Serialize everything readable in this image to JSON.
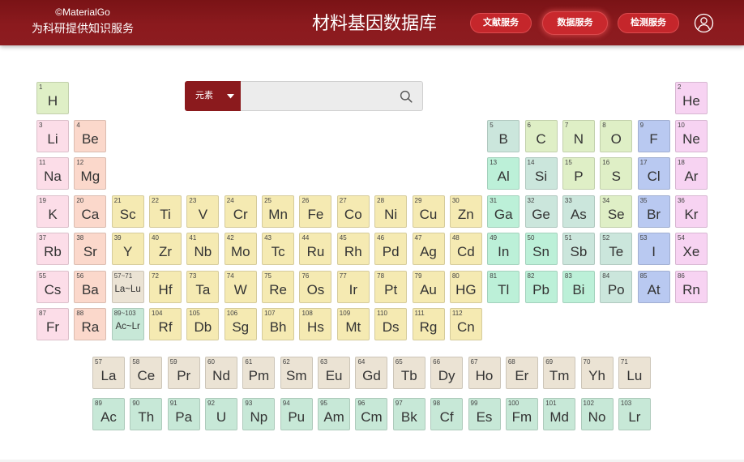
{
  "header": {
    "brand_mark": "©MaterialGo",
    "tagline": "为科研提供知识服务",
    "title": "材料基因数据库",
    "nav": [
      {
        "label": "文献服务"
      },
      {
        "label": "数据服务"
      },
      {
        "label": "检测服务"
      }
    ],
    "avatar_icon": "user-circle-icon",
    "colors": {
      "bar": "#8b1a1e",
      "pill": "#c5262b"
    }
  },
  "search": {
    "type_label": "元素",
    "caret_icon": "caret-down-icon",
    "value": "",
    "search_icon": "search-icon"
  },
  "periods": [
    [
      {
        "n": "1",
        "s": "H",
        "c": "#dfefc6"
      },
      {
        "n": "2",
        "s": "He",
        "c": "#f7d3f2"
      }
    ],
    [
      {
        "n": "3",
        "s": "Li",
        "c": "#fcdde8"
      },
      {
        "n": "4",
        "s": "Be",
        "c": "#fbd8cb"
      },
      {
        "n": "5",
        "s": "B",
        "c": "#cbe6dc"
      },
      {
        "n": "6",
        "s": "C",
        "c": "#dfefc6"
      },
      {
        "n": "7",
        "s": "N",
        "c": "#dfefc6"
      },
      {
        "n": "8",
        "s": "O",
        "c": "#dfefc6"
      },
      {
        "n": "9",
        "s": "F",
        "c": "#b9c9f1"
      },
      {
        "n": "10",
        "s": "Ne",
        "c": "#f7d3f2"
      }
    ],
    [
      {
        "n": "11",
        "s": "Na",
        "c": "#fcdde8"
      },
      {
        "n": "12",
        "s": "Mg",
        "c": "#fbd8cb"
      },
      {
        "n": "13",
        "s": "Al",
        "c": "#bcf0d8"
      },
      {
        "n": "14",
        "s": "Si",
        "c": "#cbe6dc"
      },
      {
        "n": "15",
        "s": "P",
        "c": "#dfefc6"
      },
      {
        "n": "16",
        "s": "S",
        "c": "#dfefc6"
      },
      {
        "n": "17",
        "s": "Cl",
        "c": "#b9c9f1"
      },
      {
        "n": "18",
        "s": "Ar",
        "c": "#f7d3f2"
      }
    ],
    [
      {
        "n": "19",
        "s": "K",
        "c": "#fcdde8"
      },
      {
        "n": "20",
        "s": "Ca",
        "c": "#fbd8cb"
      },
      {
        "n": "21",
        "s": "Sc",
        "c": "#f5eab2"
      },
      {
        "n": "22",
        "s": "Ti",
        "c": "#f5eab2"
      },
      {
        "n": "23",
        "s": "V",
        "c": "#f5eab2"
      },
      {
        "n": "24",
        "s": "Cr",
        "c": "#f5eab2"
      },
      {
        "n": "25",
        "s": "Mn",
        "c": "#f5eab2"
      },
      {
        "n": "26",
        "s": "Fe",
        "c": "#f5eab2"
      },
      {
        "n": "27",
        "s": "Co",
        "c": "#f5eab2"
      },
      {
        "n": "28",
        "s": "Ni",
        "c": "#f5eab2"
      },
      {
        "n": "29",
        "s": "Cu",
        "c": "#f5eab2"
      },
      {
        "n": "30",
        "s": "Zn",
        "c": "#f5eab2"
      },
      {
        "n": "31",
        "s": "Ga",
        "c": "#bcf0d8"
      },
      {
        "n": "32",
        "s": "Ge",
        "c": "#cbe6dc"
      },
      {
        "n": "33",
        "s": "As",
        "c": "#cbe6dc"
      },
      {
        "n": "34",
        "s": "Se",
        "c": "#dfefc6"
      },
      {
        "n": "35",
        "s": "Br",
        "c": "#b9c9f1"
      },
      {
        "n": "36",
        "s": "Kr",
        "c": "#f7d3f2"
      }
    ],
    [
      {
        "n": "37",
        "s": "Rb",
        "c": "#fcdde8"
      },
      {
        "n": "38",
        "s": "Sr",
        "c": "#fbd8cb"
      },
      {
        "n": "39",
        "s": "Y",
        "c": "#f5eab2"
      },
      {
        "n": "40",
        "s": "Zr",
        "c": "#f5eab2"
      },
      {
        "n": "41",
        "s": "Nb",
        "c": "#f5eab2"
      },
      {
        "n": "42",
        "s": "Mo",
        "c": "#f5eab2"
      },
      {
        "n": "43",
        "s": "Tc",
        "c": "#f5eab2"
      },
      {
        "n": "44",
        "s": "Ru",
        "c": "#f5eab2"
      },
      {
        "n": "45",
        "s": "Rh",
        "c": "#f5eab2"
      },
      {
        "n": "46",
        "s": "Pd",
        "c": "#f5eab2"
      },
      {
        "n": "47",
        "s": "Ag",
        "c": "#f5eab2"
      },
      {
        "n": "48",
        "s": "Cd",
        "c": "#f5eab2"
      },
      {
        "n": "49",
        "s": "In",
        "c": "#bcf0d8"
      },
      {
        "n": "50",
        "s": "Sn",
        "c": "#bcf0d8"
      },
      {
        "n": "51",
        "s": "Sb",
        "c": "#cbe6dc"
      },
      {
        "n": "52",
        "s": "Te",
        "c": "#cbe6dc"
      },
      {
        "n": "53",
        "s": "I",
        "c": "#b9c9f1"
      },
      {
        "n": "54",
        "s": "Xe",
        "c": "#f7d3f2"
      }
    ],
    [
      {
        "n": "55",
        "s": "Cs",
        "c": "#fcdde8"
      },
      {
        "n": "56",
        "s": "Ba",
        "c": "#fbd8cb"
      },
      {
        "n": "57~71",
        "s": "La~Lu",
        "c": "#ebe3d4"
      },
      {
        "n": "72",
        "s": "Hf",
        "c": "#f5eab2"
      },
      {
        "n": "73",
        "s": "Ta",
        "c": "#f5eab2"
      },
      {
        "n": "74",
        "s": "W",
        "c": "#f5eab2"
      },
      {
        "n": "75",
        "s": "Re",
        "c": "#f5eab2"
      },
      {
        "n": "76",
        "s": "Os",
        "c": "#f5eab2"
      },
      {
        "n": "77",
        "s": "Ir",
        "c": "#f5eab2"
      },
      {
        "n": "78",
        "s": "Pt",
        "c": "#f5eab2"
      },
      {
        "n": "79",
        "s": "Au",
        "c": "#f5eab2"
      },
      {
        "n": "80",
        "s": "HG",
        "c": "#f5eab2"
      },
      {
        "n": "81",
        "s": "Tl",
        "c": "#bcf0d8"
      },
      {
        "n": "82",
        "s": "Pb",
        "c": "#bcf0d8"
      },
      {
        "n": "83",
        "s": "Bi",
        "c": "#bcf0d8"
      },
      {
        "n": "84",
        "s": "Po",
        "c": "#cbe6dc"
      },
      {
        "n": "85",
        "s": "At",
        "c": "#b9c9f1"
      },
      {
        "n": "86",
        "s": "Rn",
        "c": "#f7d3f2"
      }
    ],
    [
      {
        "n": "87",
        "s": "Fr",
        "c": "#fcdde8"
      },
      {
        "n": "88",
        "s": "Ra",
        "c": "#fbd8cb"
      },
      {
        "n": "89~103",
        "s": "Ac~Lr",
        "c": "#c7e8d7"
      },
      {
        "n": "104",
        "s": "Rf",
        "c": "#f5eab2"
      },
      {
        "n": "105",
        "s": "Db",
        "c": "#f5eab2"
      },
      {
        "n": "106",
        "s": "Sg",
        "c": "#f5eab2"
      },
      {
        "n": "107",
        "s": "Bh",
        "c": "#f5eab2"
      },
      {
        "n": "108",
        "s": "Hs",
        "c": "#f5eab2"
      },
      {
        "n": "109",
        "s": "Mt",
        "c": "#f5eab2"
      },
      {
        "n": "110",
        "s": "Ds",
        "c": "#f5eab2"
      },
      {
        "n": "111",
        "s": "Rg",
        "c": "#f5eab2"
      },
      {
        "n": "112",
        "s": "Cn",
        "c": "#f5eab2"
      }
    ]
  ],
  "lanthanides": [
    {
      "n": "57",
      "s": "La",
      "c": "#ebe3d4"
    },
    {
      "n": "58",
      "s": "Ce",
      "c": "#ebe3d4"
    },
    {
      "n": "59",
      "s": "Pr",
      "c": "#ebe3d4"
    },
    {
      "n": "60",
      "s": "Nd",
      "c": "#ebe3d4"
    },
    {
      "n": "61",
      "s": "Pm",
      "c": "#ebe3d4"
    },
    {
      "n": "62",
      "s": "Sm",
      "c": "#ebe3d4"
    },
    {
      "n": "63",
      "s": "Eu",
      "c": "#ebe3d4"
    },
    {
      "n": "64",
      "s": "Gd",
      "c": "#ebe3d4"
    },
    {
      "n": "65",
      "s": "Tb",
      "c": "#ebe3d4"
    },
    {
      "n": "66",
      "s": "Dy",
      "c": "#ebe3d4"
    },
    {
      "n": "67",
      "s": "Ho",
      "c": "#ebe3d4"
    },
    {
      "n": "68",
      "s": "Er",
      "c": "#ebe3d4"
    },
    {
      "n": "69",
      "s": "Tm",
      "c": "#ebe3d4"
    },
    {
      "n": "70",
      "s": "Yh",
      "c": "#ebe3d4"
    },
    {
      "n": "71",
      "s": "Lu",
      "c": "#ebe3d4"
    }
  ],
  "actinides": [
    {
      "n": "89",
      "s": "Ac",
      "c": "#c7e8d7"
    },
    {
      "n": "90",
      "s": "Th",
      "c": "#c7e8d7"
    },
    {
      "n": "91",
      "s": "Pa",
      "c": "#c7e8d7"
    },
    {
      "n": "92",
      "s": "U",
      "c": "#c7e8d7"
    },
    {
      "n": "93",
      "s": "Np",
      "c": "#c7e8d7"
    },
    {
      "n": "94",
      "s": "Pu",
      "c": "#c7e8d7"
    },
    {
      "n": "95",
      "s": "Am",
      "c": "#c7e8d7"
    },
    {
      "n": "96",
      "s": "Cm",
      "c": "#c7e8d7"
    },
    {
      "n": "97",
      "s": "Bk",
      "c": "#c7e8d7"
    },
    {
      "n": "98",
      "s": "Cf",
      "c": "#c7e8d7"
    },
    {
      "n": "99",
      "s": "Es",
      "c": "#c7e8d7"
    },
    {
      "n": "100",
      "s": "Fm",
      "c": "#c7e8d7"
    },
    {
      "n": "101",
      "s": "Md",
      "c": "#c7e8d7"
    },
    {
      "n": "102",
      "s": "No",
      "c": "#c7e8d7"
    },
    {
      "n": "103",
      "s": "Lr",
      "c": "#c7e8d7"
    }
  ]
}
